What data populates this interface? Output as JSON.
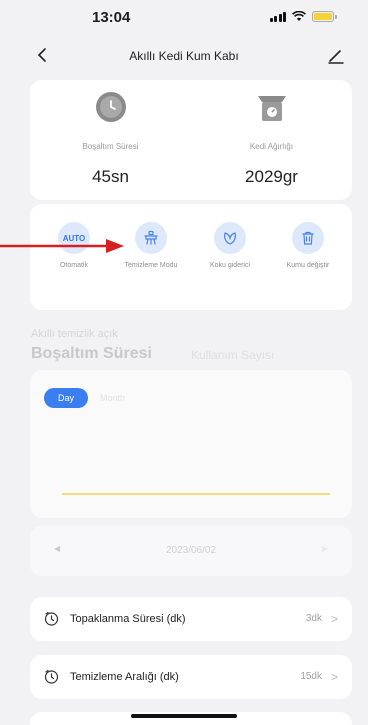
{
  "status_bar": {
    "time": "13:04"
  },
  "nav": {
    "title": "Akıllı Kedi Kum Kabı"
  },
  "stats": {
    "drain_label": "Boşaltım Süresi",
    "drain_value": "45sn",
    "weight_label": "Kedi Ağırlığı",
    "weight_value": "2029gr"
  },
  "modes": {
    "auto_badge": "AUTO",
    "items": [
      {
        "label": "Otomatik",
        "icon": "auto-icon"
      },
      {
        "label": "Temizleme Modu",
        "icon": "cleaning-mode-icon"
      },
      {
        "label": "Koku giderici",
        "icon": "leaf-icon"
      },
      {
        "label": "Kumu değiştir",
        "icon": "trash-icon"
      }
    ]
  },
  "section": {
    "smart_cleaning_text": "Akıllı temizlik açık",
    "tab_active": "Boşaltım Süresi",
    "tab_inactive": "Kullanım Sayısı"
  },
  "chart_toggle": {
    "day": "Day",
    "month": "Month"
  },
  "date_nav": {
    "prev": "◀",
    "date": "2023/06/02",
    "next": "▶"
  },
  "settings": [
    {
      "label": "Topaklanma Süresi (dk)",
      "value": "3dk",
      "icon": "clock-icon"
    },
    {
      "label": "Temizleme Aralığı (dk)",
      "value": "15dk",
      "icon": "clock-icon"
    }
  ],
  "colors": {
    "accent_blue": "#3a7ef0",
    "annotation_red": "#d42020",
    "chart_line": "#f6dc7a"
  }
}
